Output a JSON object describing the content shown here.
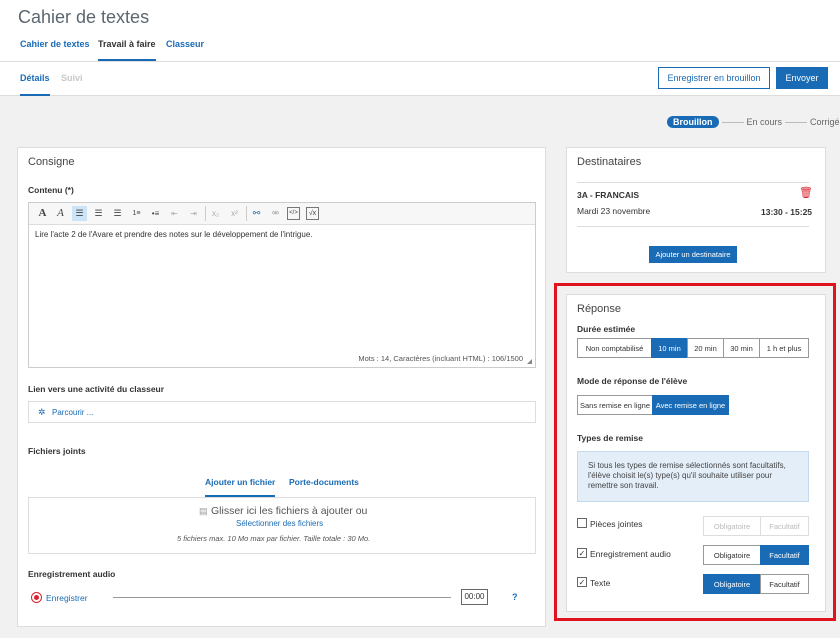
{
  "app": {
    "title": "Cahier de textes"
  },
  "nav": {
    "tabs": [
      "Cahier de textes",
      "Travail à faire",
      "Classeur"
    ]
  },
  "subnav": {
    "tabs": [
      "Détails",
      "Suivi"
    ]
  },
  "actions": {
    "draft": "Enregistrer en brouillon",
    "send": "Envoyer"
  },
  "status": {
    "steps": [
      "Brouillon",
      "En cours",
      "Corrigé"
    ]
  },
  "consigne": {
    "title": "Consigne",
    "content_label": "Contenu (*)",
    "text": "Lire l'acte 2 de l'Avare et prendre des notes sur le développement de l'intrigue.",
    "count": "Mots : 14, Caractères (incluant HTML) : 106/1500",
    "link_label": "Lien vers une activité du classeur",
    "browse": "Parcourir ...",
    "files_label": "Fichiers joints",
    "files_tabs": [
      "Ajouter un fichier",
      "Porte-documents"
    ],
    "drop_text": "Glisser ici les fichiers à ajouter ou",
    "select_files": "Sélectionner des fichiers",
    "files_limits": "5 fichiers max. 10 Mo max par fichier. Taille totale : 30 Mo.",
    "audio_label": "Enregistrement audio",
    "record": "Enregistrer",
    "time": "00:00",
    "help": "?"
  },
  "destinataires": {
    "title": "Destinataires",
    "class_name": "3A - FRANCAIS",
    "date": "Mardi 23 novembre",
    "time": "13:30 - 15:25",
    "add": "Ajouter un destinataire"
  },
  "reponse": {
    "title": "Réponse",
    "duration_label": "Durée estimée",
    "durations": [
      "Non comptabilisé",
      "10 min",
      "20 min",
      "30 min",
      "1 h et plus"
    ],
    "mode_label": "Mode de réponse de l'élève",
    "modes": [
      "Sans remise en ligne",
      "Avec remise en ligne"
    ],
    "types_label": "Types de remise",
    "info": "Si tous les types de remise sélectionnés sont facultatifs, l'élève choisit le(s) type(s) qu'il souhaite utiliser pour remettre son travail.",
    "types": [
      {
        "label": "Pièces jointes",
        "checked": false,
        "check": ""
      },
      {
        "label": "Enregistrement audio",
        "checked": true,
        "check": "✓"
      },
      {
        "label": "Texte",
        "checked": true,
        "check": "✓"
      }
    ],
    "options": [
      "Obligatoire",
      "Facultatif"
    ]
  },
  "colors": {
    "accent": "#1a6bb5",
    "highlight": "#e0141e",
    "delete": "#d9232e",
    "record": "#d9232e"
  }
}
